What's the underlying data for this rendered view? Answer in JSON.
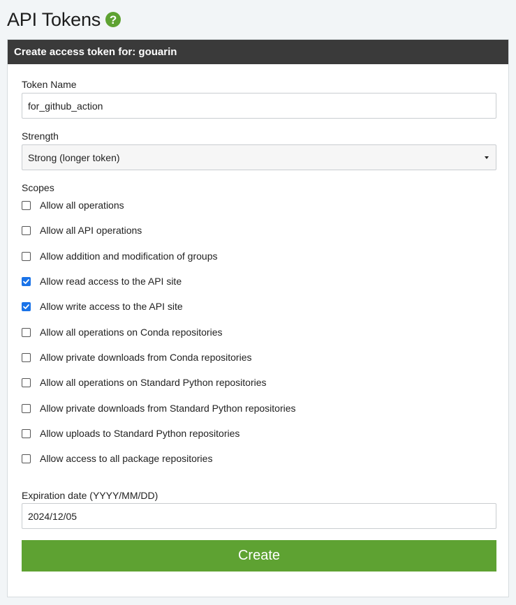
{
  "header": {
    "title": "API Tokens",
    "help_glyph": "?",
    "help_icon": "question-circle-icon"
  },
  "panel": {
    "title": "Create access token for: gouarin"
  },
  "form": {
    "token_name": {
      "label": "Token Name",
      "value": "for_github_action"
    },
    "strength": {
      "label": "Strength",
      "selected": "Strong (longer token)"
    },
    "scopes": {
      "label": "Scopes",
      "items": [
        {
          "label": "Allow all operations",
          "checked": false
        },
        {
          "label": "Allow all API operations",
          "checked": false
        },
        {
          "label": "Allow addition and modification of groups",
          "checked": false
        },
        {
          "label": "Allow read access to the API site",
          "checked": true
        },
        {
          "label": "Allow write access to the API site",
          "checked": true
        },
        {
          "label": "Allow all operations on Conda repositories",
          "checked": false
        },
        {
          "label": "Allow private downloads from Conda repositories",
          "checked": false
        },
        {
          "label": "Allow all operations on Standard Python repositories",
          "checked": false
        },
        {
          "label": "Allow private downloads from Standard Python repositories",
          "checked": false
        },
        {
          "label": "Allow uploads to Standard Python repositories",
          "checked": false
        },
        {
          "label": "Allow access to all package repositories",
          "checked": false
        }
      ]
    },
    "expiration": {
      "label": "Expiration date (YYYY/MM/DD)",
      "value": "2024/12/05"
    },
    "submit_label": "Create"
  },
  "colors": {
    "accent_green": "#5ea232",
    "header_bar": "#3a3a3a",
    "checkbox_checked": "#1a73e8"
  }
}
